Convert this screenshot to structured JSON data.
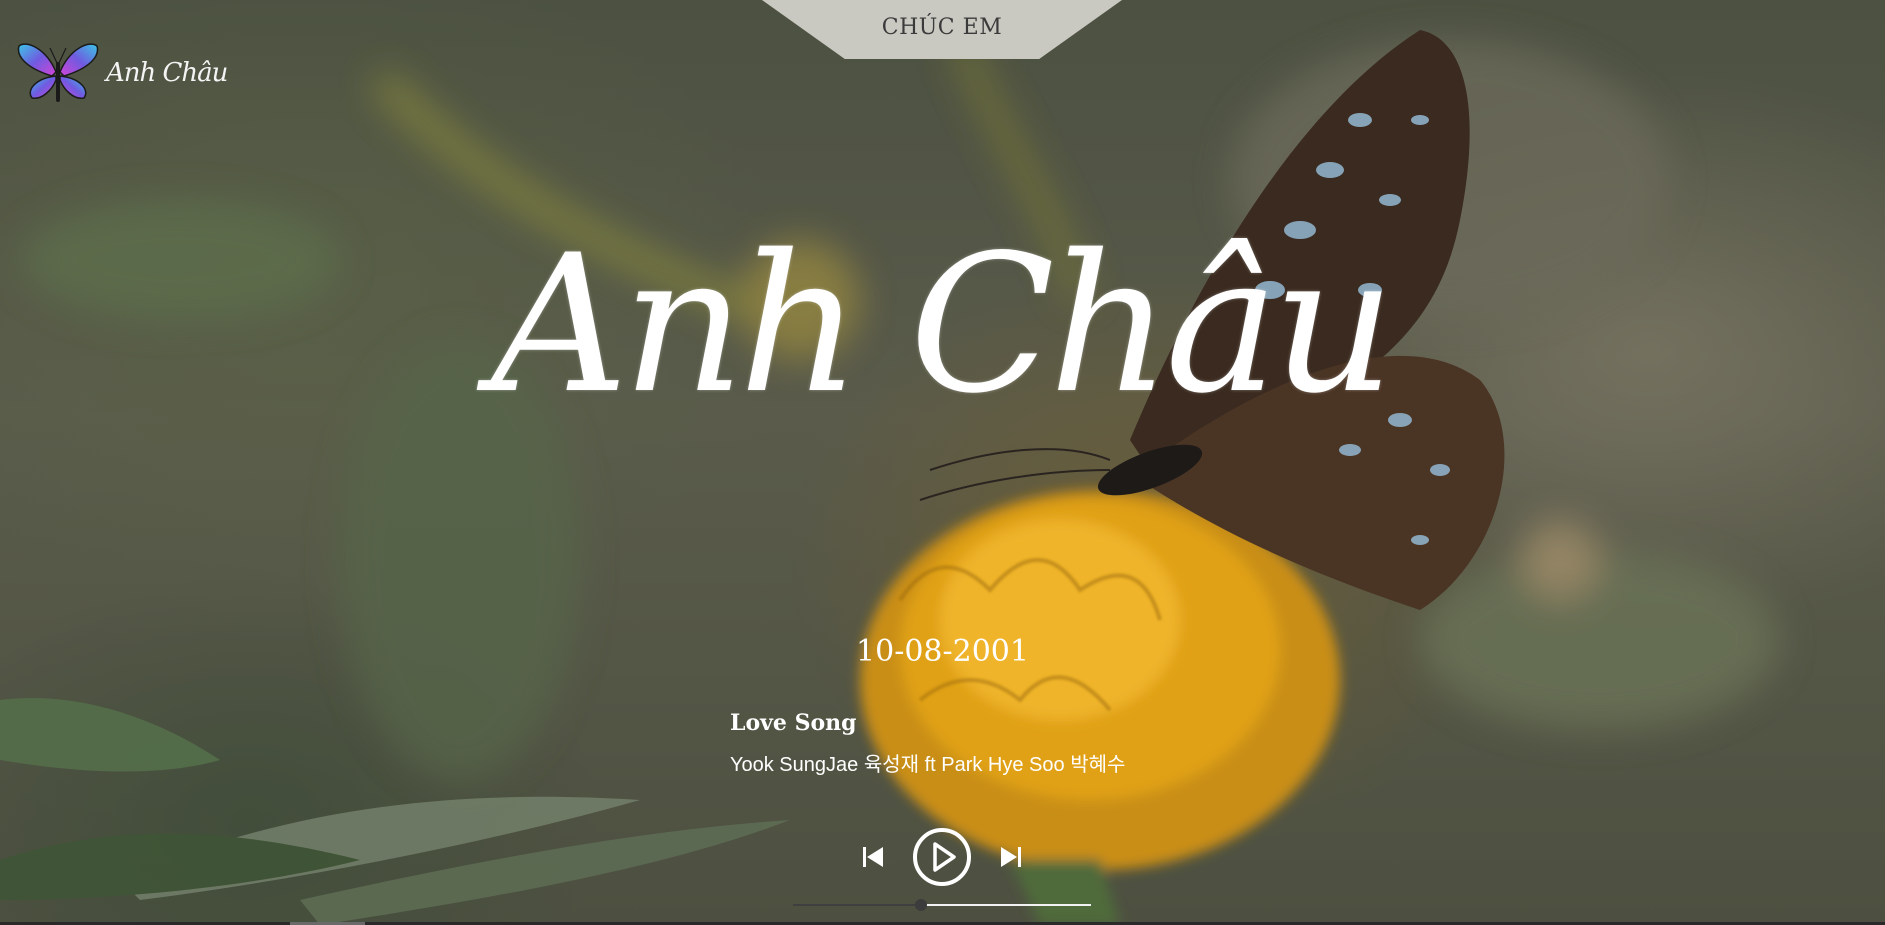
{
  "header": {
    "tab_label": "CHÚC EM"
  },
  "logo": {
    "text": "Anh Châu",
    "icon": "butterfly-icon"
  },
  "hero": {
    "title": "Anh Châu",
    "date": "10-08-2001"
  },
  "player": {
    "song_title": "Love Song",
    "artist": "Yook SungJae 육성재 ft Park Hye Soo 박혜수",
    "controls": {
      "previous_icon": "skip-previous-icon",
      "play_icon": "play-icon",
      "next_icon": "skip-next-icon"
    },
    "progress_fraction": 0.43
  },
  "colors": {
    "text": "#ffffff",
    "tab_background": "#c9c8c1",
    "tab_text": "#3b3b3b",
    "progress_track": "#f2f2f2",
    "progress_knob": "#3c3c3c"
  }
}
